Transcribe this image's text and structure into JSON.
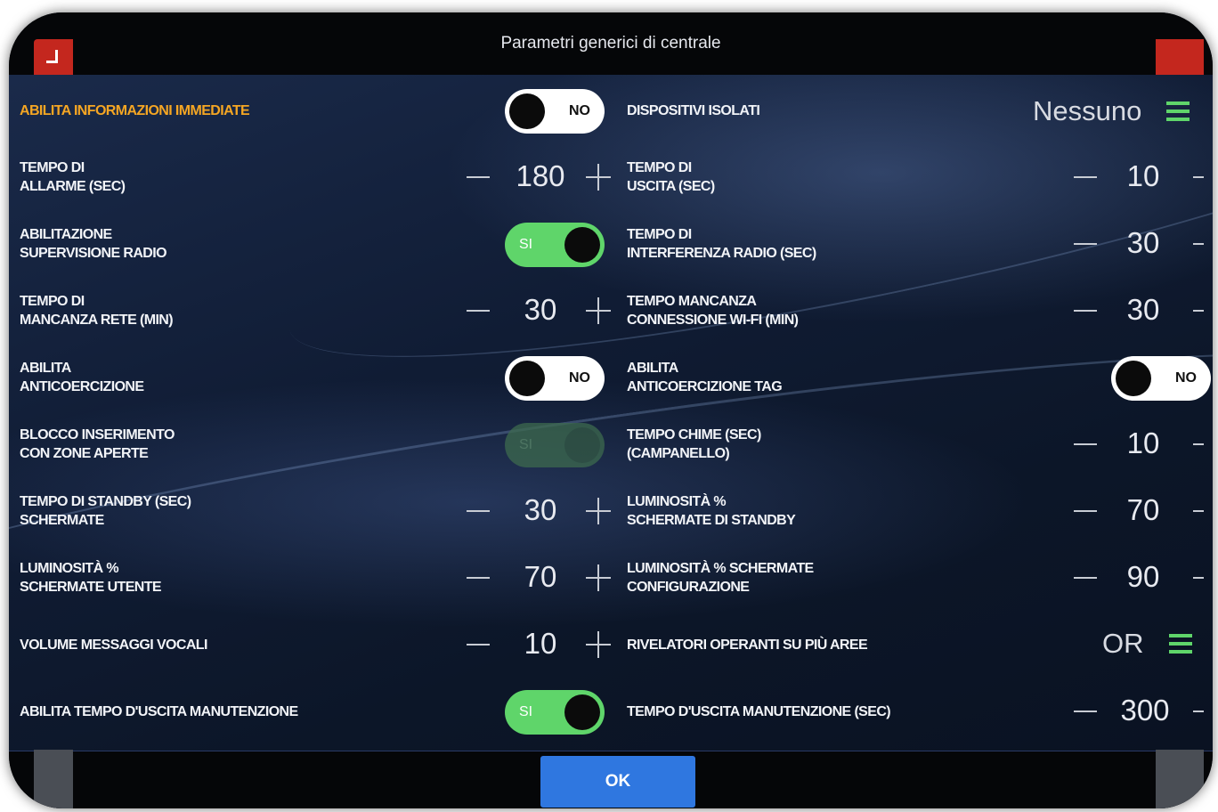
{
  "dialog": {
    "title": "Parametri generici di centrale",
    "ok_label": "OK"
  },
  "left": [
    {
      "label": "ABILITA INFORMAZIONI IMMEDIATE",
      "toggle": "NO"
    },
    {
      "label": "TEMPO DI\nALLARME (SEC)",
      "value": "180"
    },
    {
      "label": "ABILITAZIONE\nSUPERVISIONE RADIO",
      "toggle": "SI"
    },
    {
      "label": "TEMPO DI\nMANCANZA RETE (MIN)",
      "value": "30"
    },
    {
      "label": "ABILITA\nANTICOERCIZIONE",
      "toggle": "NO"
    },
    {
      "label": "BLOCCO INSERIMENTO\nCON ZONE APERTE",
      "toggle": "SI"
    },
    {
      "label": "TEMPO DI STANDBY (SEC)\nSCHERMATE",
      "value": "30"
    },
    {
      "label": "LUMINOSITÀ %\nSCHERMATE UTENTE",
      "value": "70"
    },
    {
      "label": "VOLUME MESSAGGI VOCALI",
      "value": "10"
    },
    {
      "label": "ABILITA TEMPO D'USCITA MANUTENZIONE",
      "toggle": "SI"
    }
  ],
  "right": [
    {
      "label": "DISPOSITIVI ISOLATI",
      "select": "Nessuno",
      "icon": "menu-icon"
    },
    {
      "label": "TEMPO DI\nUSCITA (SEC)",
      "value": "10"
    },
    {
      "label": "TEMPO DI\nINTERFERENZA RADIO (SEC)",
      "value": "30"
    },
    {
      "label": "TEMPO MANCANZA\nCONNESSIONE WI-FI (MIN)",
      "value": "30"
    },
    {
      "label": "ABILITA\nANTICOERCIZIONE TAG",
      "toggle": "NO"
    },
    {
      "label": "TEMPO CHIME (SEC)\n(CAMPANELLO)",
      "value": "10"
    },
    {
      "label": "LUMINOSITÀ %\nSCHERMATE DI STANDBY",
      "value": "70"
    },
    {
      "label": "LUMINOSITÀ % SCHERMATE\nCONFIGURAZIONE",
      "value": "90"
    },
    {
      "label": "RIVELATORI OPERANTI SU PIÙ AREE",
      "select": "OR",
      "icon": "menu-icon"
    },
    {
      "label": "TEMPO D'USCITA MANUTENZIONE (SEC)",
      "value": "300"
    }
  ],
  "colors": {
    "accent_label": "#f5a623",
    "toggle_on": "#5fd56a",
    "ok_button": "#2f77e0",
    "menu_icon": "#5fd56a"
  }
}
